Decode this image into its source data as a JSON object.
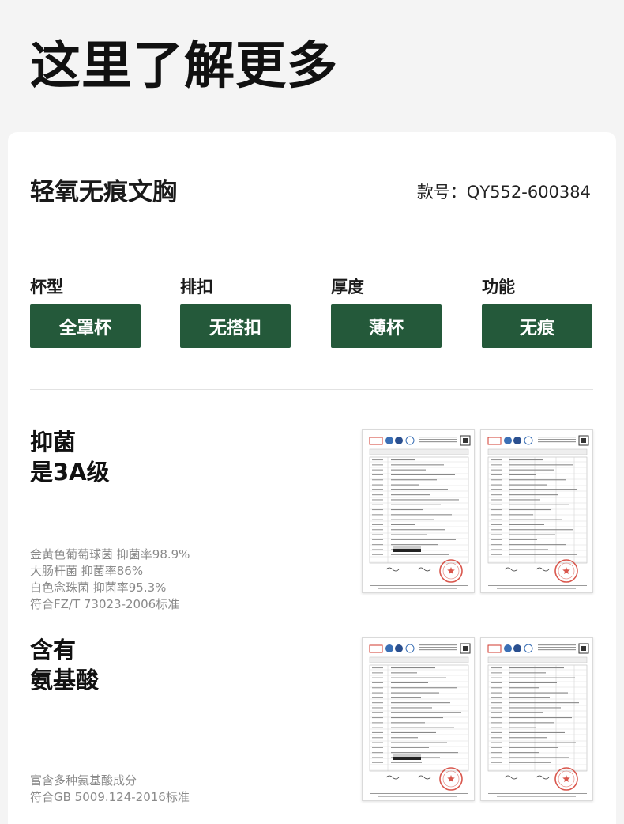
{
  "header": {
    "title": "这里了解更多"
  },
  "product": {
    "name": "轻氧无痕文胸",
    "style_no": "款号：QY552-600384"
  },
  "attributes": [
    {
      "label": "杯型",
      "value": "全罩杯"
    },
    {
      "label": "排扣",
      "value": "无搭扣"
    },
    {
      "label": "厚度",
      "value": "薄杯"
    },
    {
      "label": "功能",
      "value": "无痕"
    }
  ],
  "features": [
    {
      "title_line1": "抑菌",
      "title_line2": "是3A级",
      "desc": [
        "金黄色葡萄球菌 抑菌率98.9%",
        "大肠杆菌 抑菌率86%",
        "白色念珠菌 抑菌率95.3%",
        "符合FZ/T 73023-2006标准"
      ]
    },
    {
      "title_line1": "含有",
      "title_line2": "氨基酸",
      "desc": [
        "富含多种氨基酸成分",
        "符合GB 5009.124-2016标准"
      ]
    }
  ],
  "colors": {
    "accent": "#24593a",
    "stamp": "#d23a2e",
    "background": "#f4f4f4"
  },
  "icons": {
    "certificate": "test-report-image",
    "stamp": "seal-stamp-icon"
  }
}
